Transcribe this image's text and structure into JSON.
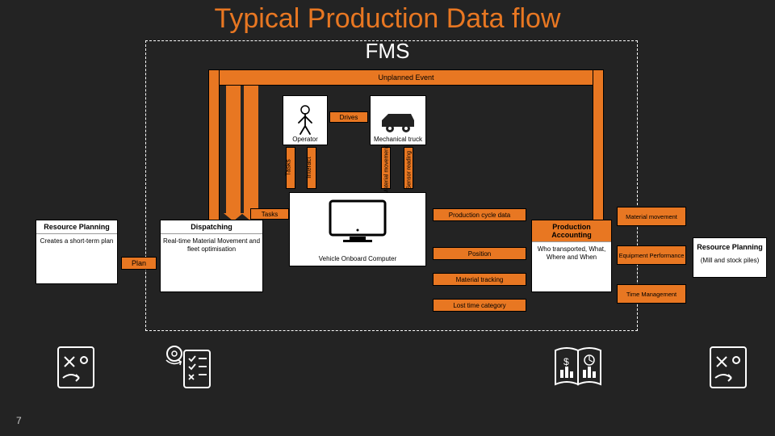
{
  "title": "Typical Production Data flow",
  "fms": "FMS",
  "page_number": "7",
  "unplanned_event": "Unplanned Event",
  "drives": "Drives",
  "operator": "Operator",
  "truck": "Mechanical truck",
  "vertical_labels": {
    "tasks": "Tasks",
    "interact": "Interact",
    "material_movement": "Material movement",
    "sensor_reading": "Sensor reading"
  },
  "tasks_arrow": "Tasks",
  "plan_arrow": "Plan",
  "resource_planning": {
    "title": "Resource Planning",
    "desc": "Creates a short-term plan"
  },
  "dispatching": {
    "title": "Dispatching",
    "desc": "Real-time Material Movement and fleet optimisation"
  },
  "voc": "Vehicle Onboard Computer",
  "mid_bars": {
    "production_cycle": "Production cycle data",
    "position": "Position",
    "material_tracking": "Material tracking",
    "lost_time": "Lost time category"
  },
  "production_accounting": {
    "title": "Production Accounting",
    "desc": "Who transported, What, Where and When"
  },
  "right_bars": {
    "material_movement": "Material movement",
    "equipment_performance": "Equipment Performance",
    "time_management": "Time Management"
  },
  "resource_planning_right": {
    "title": "Resource Planning",
    "desc": "(Mill and stock piles)"
  }
}
